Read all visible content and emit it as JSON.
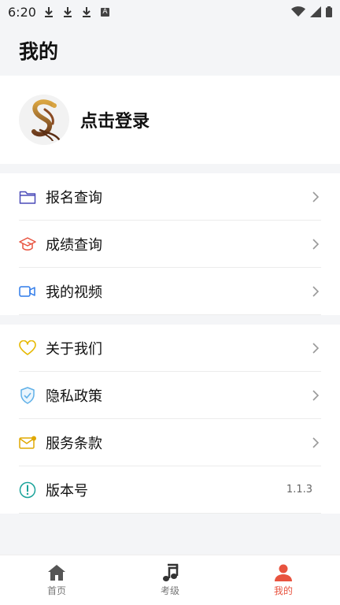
{
  "status_bar": {
    "time": "6:20",
    "a_glyph": "A"
  },
  "header": {
    "title": "我的"
  },
  "profile": {
    "login_text": "点击登录"
  },
  "menu_group_1": [
    {
      "label": "报名查询",
      "icon": "folder-icon",
      "color": "#4a4ab8"
    },
    {
      "label": "成绩查询",
      "icon": "graduation-cap-icon",
      "color": "#e8533f"
    },
    {
      "label": "我的视频",
      "icon": "video-icon",
      "color": "#2f7bea"
    }
  ],
  "menu_group_2": [
    {
      "label": "关于我们",
      "icon": "heart-icon",
      "color": "#e6b800"
    },
    {
      "label": "隐私政策",
      "icon": "shield-check-icon",
      "color": "#5fb0e8"
    },
    {
      "label": "服务条款",
      "icon": "mail-icon",
      "color": "#e0a800"
    },
    {
      "label": "版本号",
      "icon": "info-icon",
      "color": "#1aa39a",
      "value": "1.1.3"
    }
  ],
  "tabs": [
    {
      "label": "首页",
      "icon": "home-icon",
      "active": false
    },
    {
      "label": "考级",
      "icon": "music-note-icon",
      "active": false
    },
    {
      "label": "我的",
      "icon": "user-icon",
      "active": true
    }
  ],
  "colors": {
    "accent": "#e8533f",
    "page_bg": "#f4f5f7"
  }
}
